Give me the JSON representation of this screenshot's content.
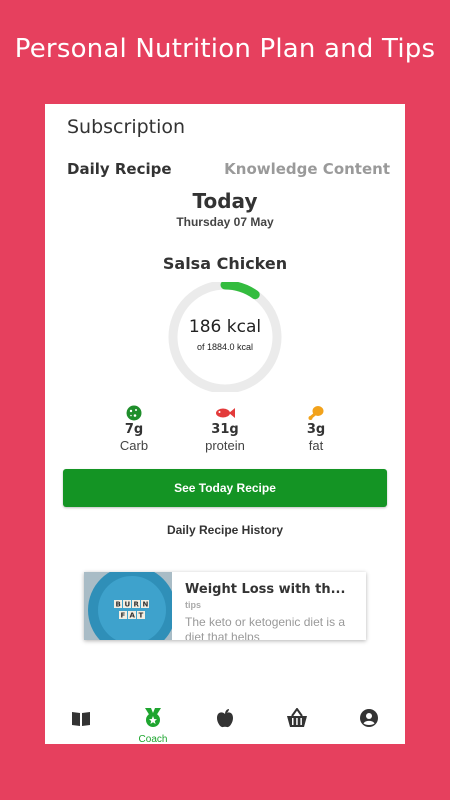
{
  "promo": {
    "headline": "Personal Nutrition Plan and Tips"
  },
  "header": {
    "title": "Subscription"
  },
  "tabs": [
    {
      "label": "Daily Recipe",
      "active": true
    },
    {
      "label": "Knowledge Content",
      "active": false
    }
  ],
  "day": {
    "title": "Today",
    "date": "Thursday 07 May"
  },
  "recipe": {
    "name": "Salsa Chicken",
    "kcal_text": "186 kcal",
    "total_text": "of 1884.0 kcal",
    "progress_fraction": 0.0987
  },
  "macros": [
    {
      "value": "7g",
      "label": "Carb",
      "icon": "cookie-icon",
      "color": "#1F8E2B"
    },
    {
      "value": "31g",
      "label": "protein",
      "icon": "fish-icon",
      "color": "#E33A3A"
    },
    {
      "value": "3g",
      "label": "fat",
      "icon": "drumstick-icon",
      "color": "#F2A21B"
    }
  ],
  "cta": {
    "label": "See Today Recipe"
  },
  "history": {
    "label": "Daily Recipe History"
  },
  "article": {
    "title": "Weight Loss with th...",
    "tag": "tips",
    "excerpt": "The keto or ketogenic diet is a diet that helps",
    "image_tiles": [
      "BURN",
      "FAT"
    ]
  },
  "nav": [
    {
      "icon": "book-icon",
      "label": ""
    },
    {
      "icon": "coach-medal-icon",
      "label": "Coach",
      "active": true
    },
    {
      "icon": "apple-icon",
      "label": ""
    },
    {
      "icon": "basket-icon",
      "label": ""
    },
    {
      "icon": "profile-icon",
      "label": ""
    }
  ],
  "colors": {
    "background": "#E6405E",
    "accent_green": "#149424",
    "ring_track": "#EBEBEB",
    "ring_progress": "#34BC3F"
  }
}
